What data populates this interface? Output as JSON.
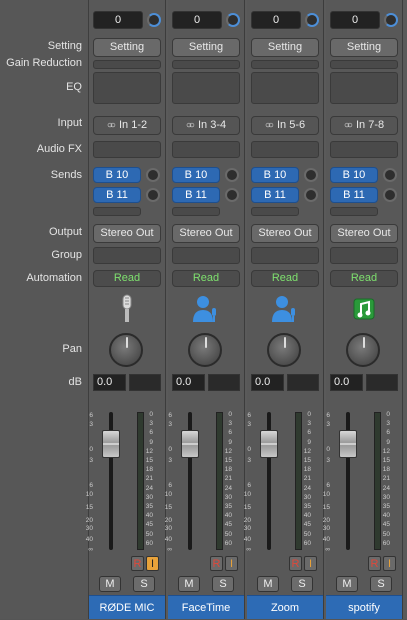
{
  "labels": [
    "Setting",
    "Gain Reduction",
    "EQ",
    "Input",
    "Audio FX",
    "Sends",
    "Output",
    "Group",
    "Automation",
    "Pan",
    "dB"
  ],
  "scale_marks": [
    "6",
    "3",
    "0",
    "3",
    "6",
    "10",
    "15",
    "20",
    "30",
    "40",
    "∞"
  ],
  "meter_marks": [
    "0",
    "3",
    "6",
    "9",
    "12",
    "15",
    "18",
    "21",
    "24",
    "30",
    "35",
    "40",
    "45",
    "50",
    "60"
  ],
  "channels": [
    {
      "name": "RØDE MIC",
      "volume": "0",
      "setting": "Setting",
      "input": "In 1-2",
      "send1": "B 10",
      "send2": "B 11",
      "output": "Stereo Out",
      "automation": "Read",
      "pan_db": "0.0",
      "icon": "microphone-icon",
      "rec": "R",
      "inmon": "I",
      "mute": "M",
      "solo": "S"
    },
    {
      "name": "FaceTime",
      "volume": "0",
      "setting": "Setting",
      "input": "In 3-4",
      "send1": "B 10",
      "send2": "B 11",
      "output": "Stereo Out",
      "automation": "Read",
      "pan_db": "0.0",
      "icon": "person-mic-icon",
      "rec": "R",
      "inmon": "I",
      "mute": "M",
      "solo": "S"
    },
    {
      "name": "Zoom",
      "volume": "0",
      "setting": "Setting",
      "input": "In 5-6",
      "send1": "B 10",
      "send2": "B 11",
      "output": "Stereo Out",
      "automation": "Read",
      "pan_db": "0.0",
      "icon": "person-mic-icon",
      "rec": "R",
      "inmon": "I",
      "mute": "M",
      "solo": "S"
    },
    {
      "name": "spotify",
      "volume": "0",
      "setting": "Setting",
      "input": "In 7-8",
      "send1": "B 10",
      "send2": "B 11",
      "output": "Stereo Out",
      "automation": "Read",
      "pan_db": "0.0",
      "icon": "music-note-icon",
      "rec": "R",
      "inmon": "I",
      "mute": "M",
      "solo": "S"
    }
  ],
  "colors": {
    "send_blue": "#2d69b3",
    "read_green": "#7ee06e",
    "rec_red": "#e0483a",
    "input_orange": "#e8a23a"
  }
}
